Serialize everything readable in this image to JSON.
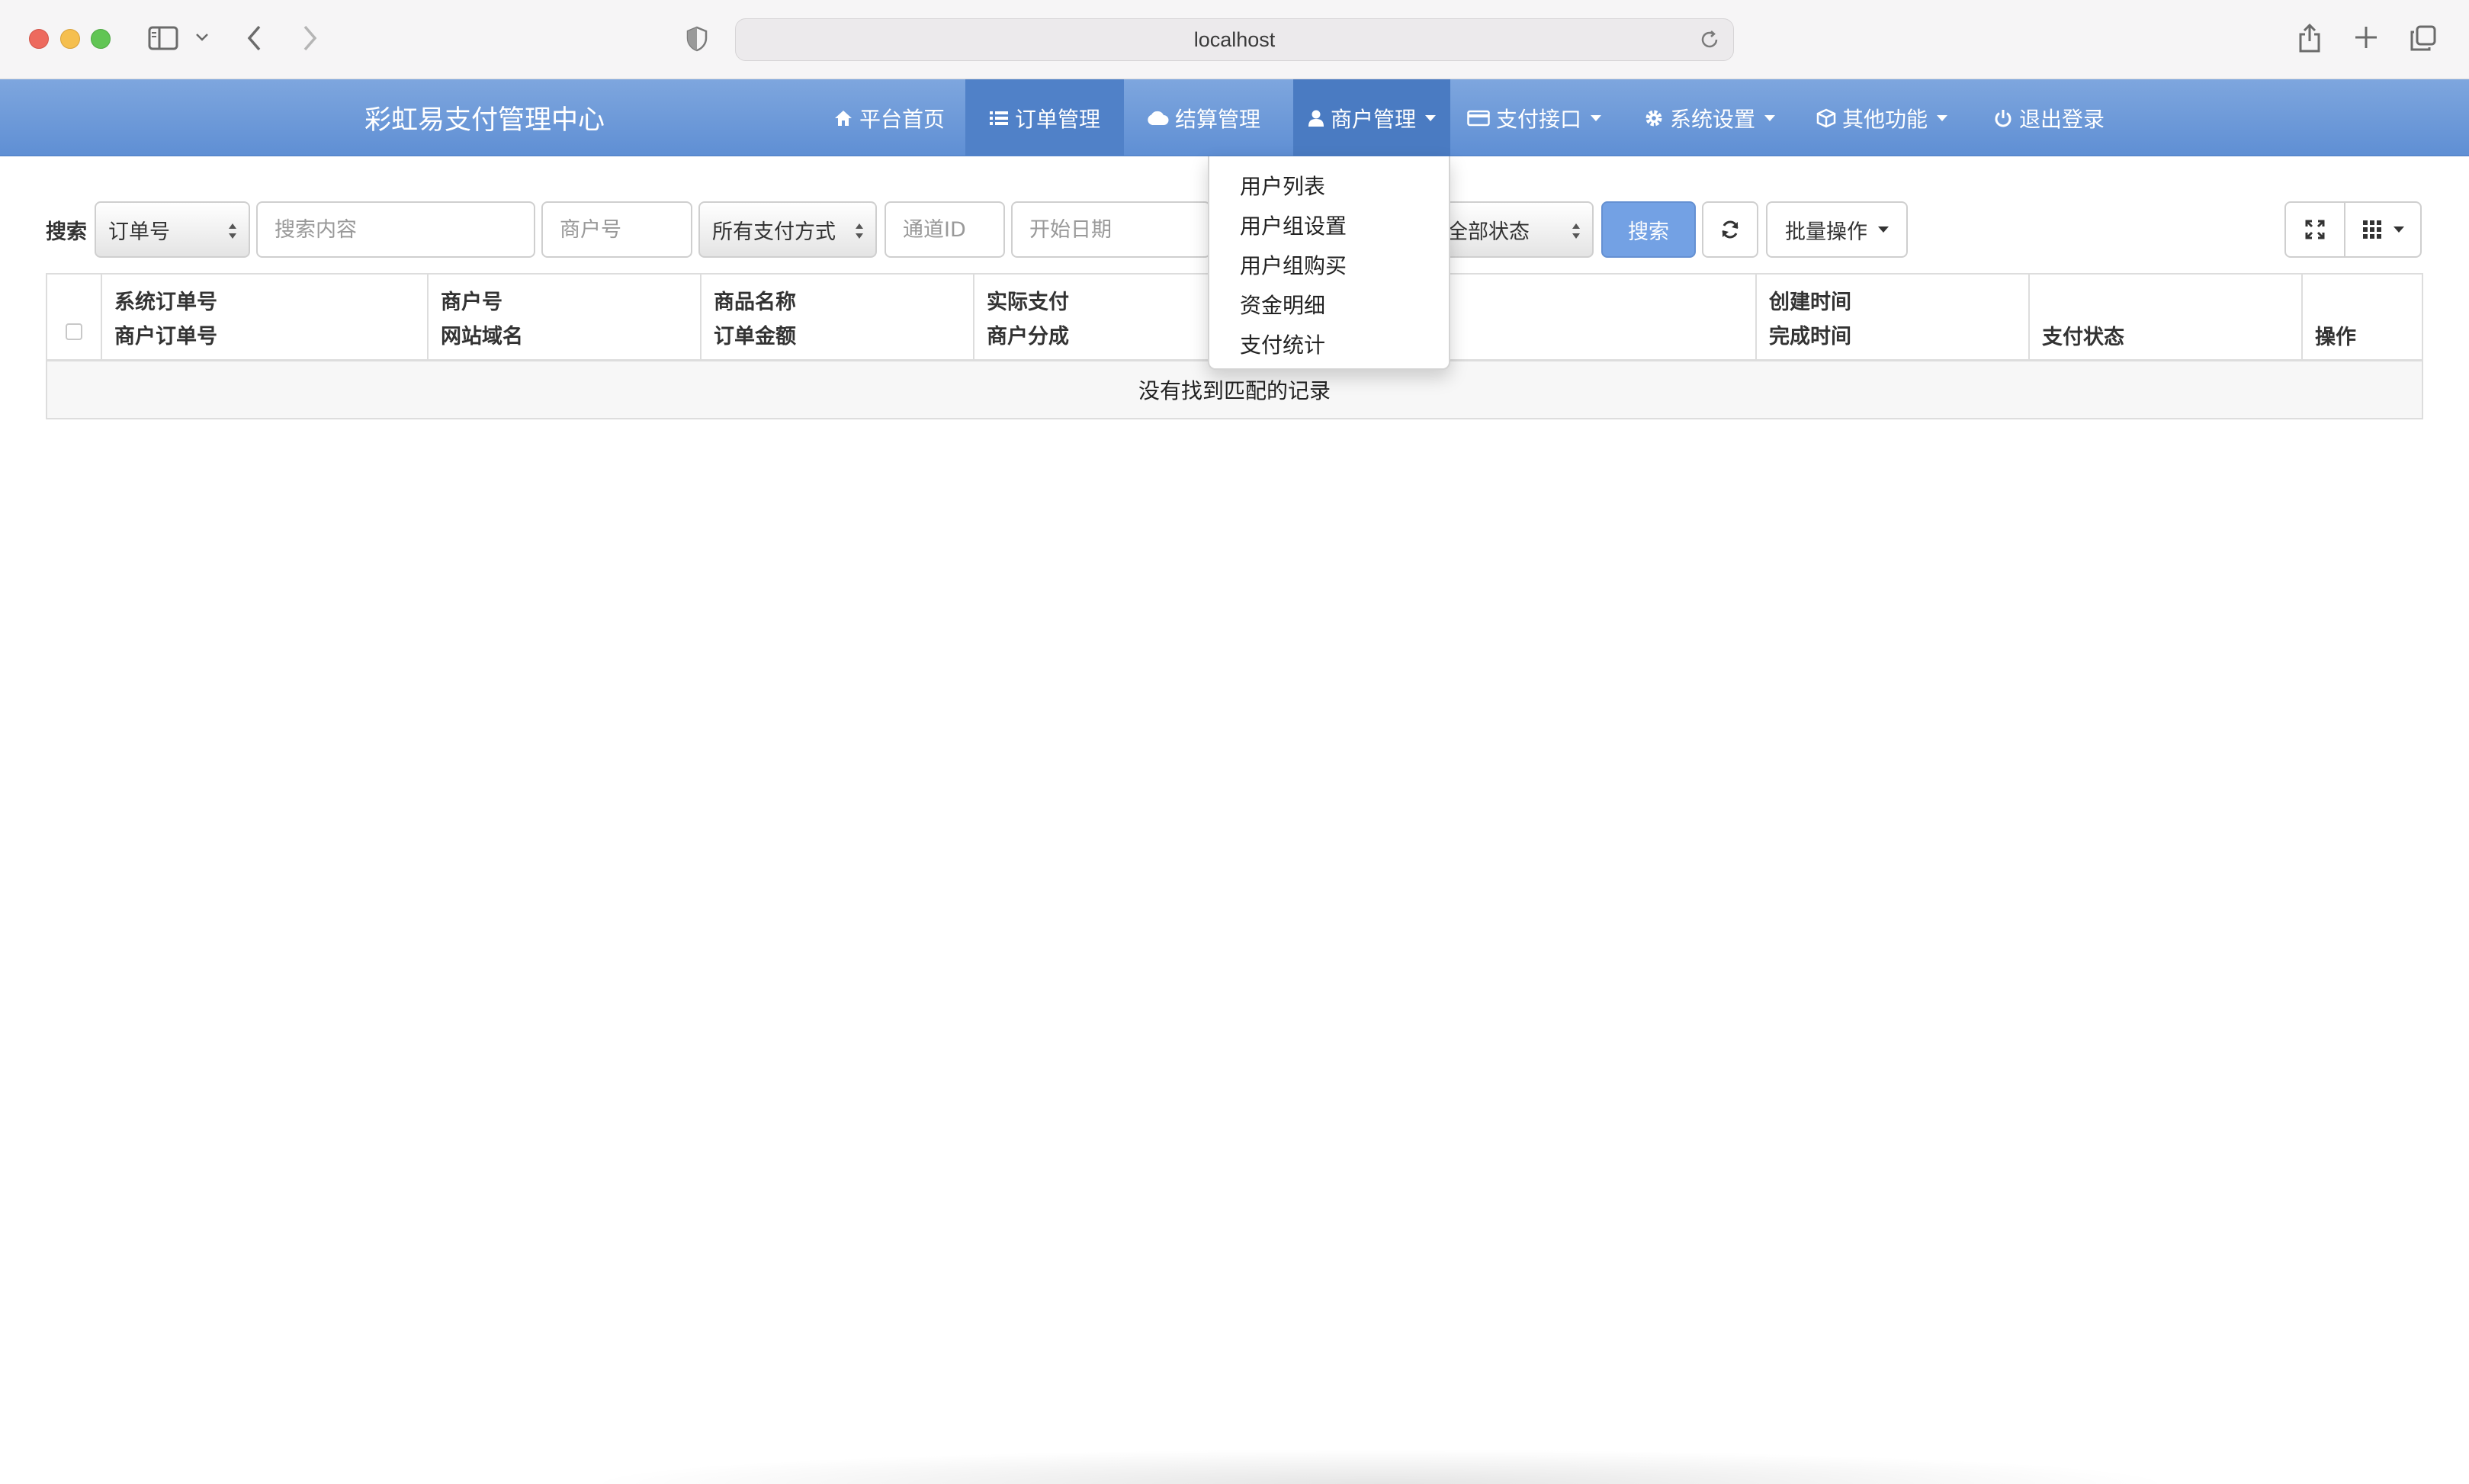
{
  "browser": {
    "url": "localhost"
  },
  "navbar": {
    "brand": "彩虹易支付管理中心",
    "items": [
      {
        "label": "平台首页",
        "icon": "home-icon"
      },
      {
        "label": "订单管理",
        "icon": "list-icon"
      },
      {
        "label": "结算管理",
        "icon": "cloud-icon"
      },
      {
        "label": "商户管理",
        "icon": "user-icon"
      },
      {
        "label": "支付接口",
        "icon": "credit-card-icon"
      },
      {
        "label": "系统设置",
        "icon": "gear-icon"
      },
      {
        "label": "其他功能",
        "icon": "cube-icon"
      },
      {
        "label": "退出登录",
        "icon": "power-icon"
      }
    ]
  },
  "dropdown": {
    "items": [
      "用户列表",
      "用户组设置",
      "用户组购买",
      "资金明细",
      "支付统计"
    ]
  },
  "toolbar": {
    "search_label": "搜索",
    "search_type": "订单号",
    "search_content_placeholder": "搜索内容",
    "merchant_placeholder": "商户号",
    "pay_type": "所有支付方式",
    "channel_placeholder": "通道ID",
    "start_date_placeholder": "开始日期",
    "status": "全部状态",
    "search_button": "搜索",
    "batch_button": "批量操作"
  },
  "table": {
    "columns": [
      {
        "line1": "系统订单号",
        "line2": "商户订单号"
      },
      {
        "line1": "商户号",
        "line2": "网站域名"
      },
      {
        "line1": "商品名称",
        "line2": "订单金额"
      },
      {
        "line1": "实际支付",
        "line2": "商户分成"
      },
      {
        "line1": "",
        "line2": ""
      },
      {
        "line1": "创建时间",
        "line2": "完成时间"
      },
      {
        "line1": "",
        "line2": "支付状态"
      },
      {
        "line1": "",
        "line2": "操作"
      }
    ],
    "empty_message": "没有找到匹配的记录"
  },
  "colors": {
    "navbar": "#6a98d9",
    "primary_button": "#73a1e4"
  }
}
